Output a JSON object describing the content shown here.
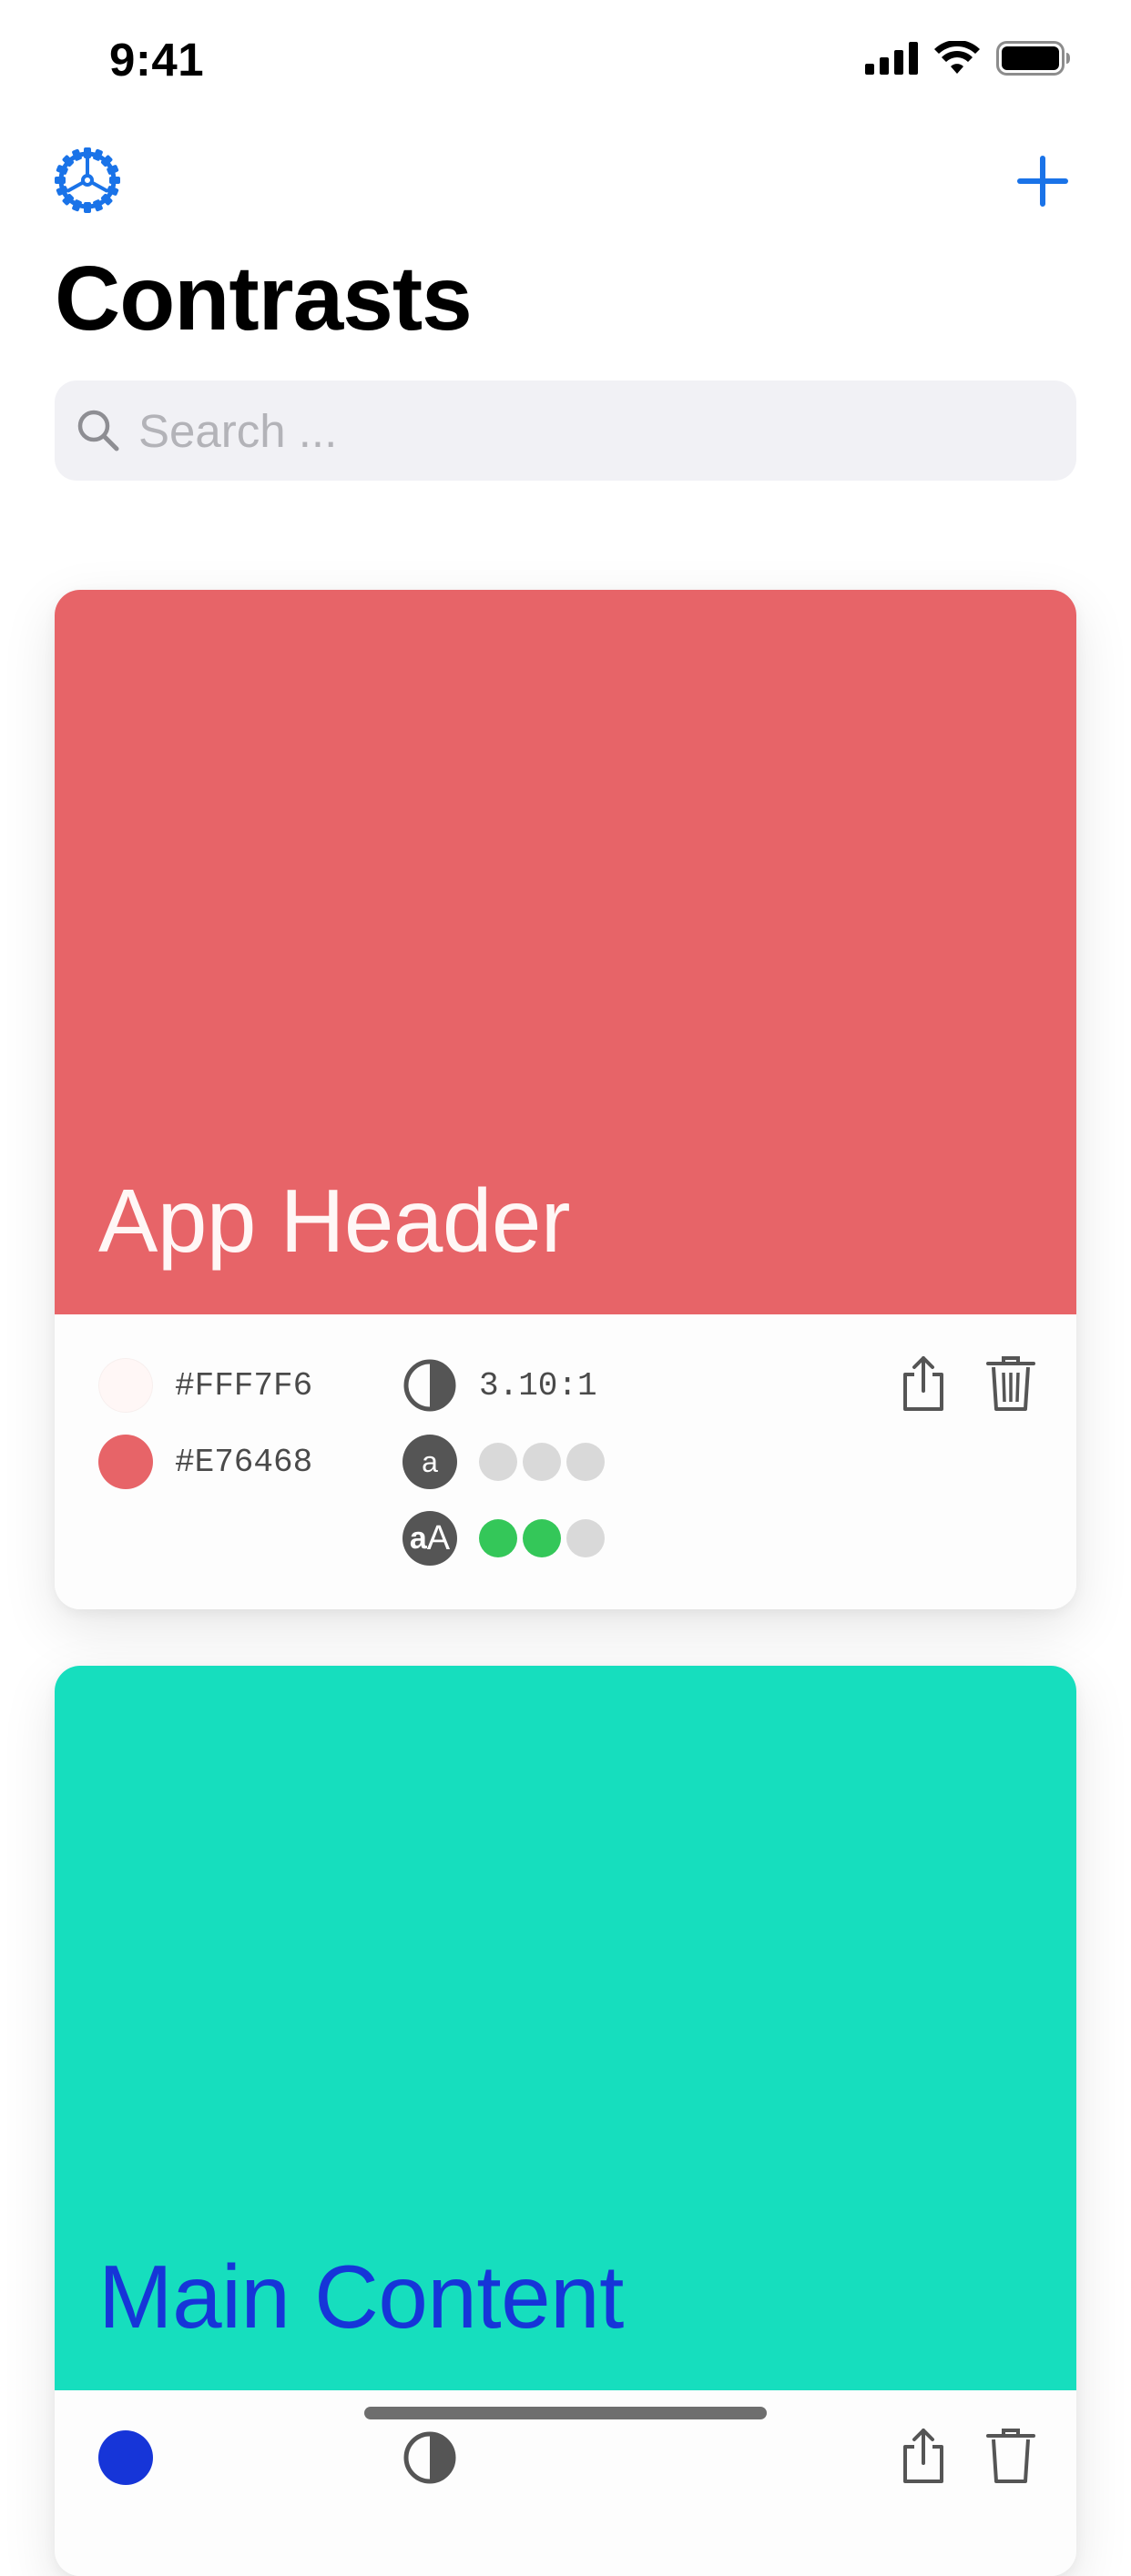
{
  "status_bar": {
    "time": "9:41"
  },
  "nav": {
    "settings_icon": "gear-icon",
    "add_icon": "plus-icon",
    "accent_color": "#1a73e8"
  },
  "page": {
    "title": "Contrasts"
  },
  "search": {
    "placeholder": "Search ...",
    "value": ""
  },
  "cards": [
    {
      "name": "App Header",
      "background_color": "#E76468",
      "text_color": "#FFF7F6",
      "colors": [
        {
          "hex": "#FFF7F6"
        },
        {
          "hex": "#E76468"
        }
      ],
      "ratio": "3.10:1",
      "normal_text_letter": "a",
      "large_text_letters": [
        "a",
        "A"
      ],
      "normal_text_rating": [
        false,
        false,
        false
      ],
      "large_text_rating": [
        true,
        true,
        false
      ]
    },
    {
      "name": "Main Content",
      "background_color": "#16DEBE",
      "text_color": "#1635D8"
    }
  ],
  "rating_colors": {
    "pass": "#34C759",
    "fail": "#D9D9D9"
  }
}
